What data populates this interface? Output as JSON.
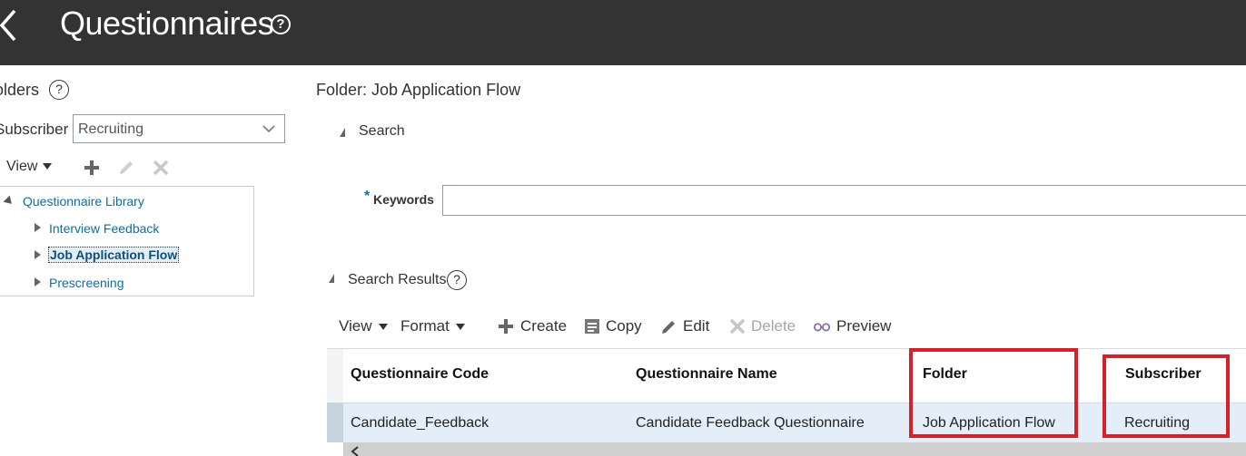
{
  "header": {
    "title": "Questionnaires",
    "help_glyph": "?"
  },
  "left": {
    "folders_label": "olders",
    "subscriber_label": "Subscriber",
    "subscriber_value": "Recruiting",
    "toolbar": {
      "view_label": "View"
    },
    "tree": {
      "root": "Questionnaire Library",
      "children": [
        "Interview Feedback",
        "Job Application Flow",
        "Prescreening"
      ],
      "selected_index": 1
    }
  },
  "main": {
    "folder_heading": "Folder: Job Application Flow",
    "search_label": "Search",
    "keywords_required": "*",
    "keywords_label": "Keywords",
    "keywords_value": "",
    "results_label": "Search Results",
    "toolbar": {
      "view": "View",
      "format": "Format",
      "create": "Create",
      "copy": "Copy",
      "edit": "Edit",
      "delete": "Delete",
      "preview": "Preview"
    },
    "table": {
      "columns": [
        "Questionnaire Code",
        "Questionnaire Name",
        "Folder",
        "Subscriber"
      ],
      "rows": [
        [
          "Candidate_Feedback",
          "Candidate Feedback Questionnaire",
          "Job Application Flow",
          "Recruiting"
        ]
      ]
    }
  },
  "colors": {
    "header_bg": "#333333",
    "link": "#0e6ea6",
    "selected_row": "#e3eef8",
    "highlight": "#d8202a"
  }
}
